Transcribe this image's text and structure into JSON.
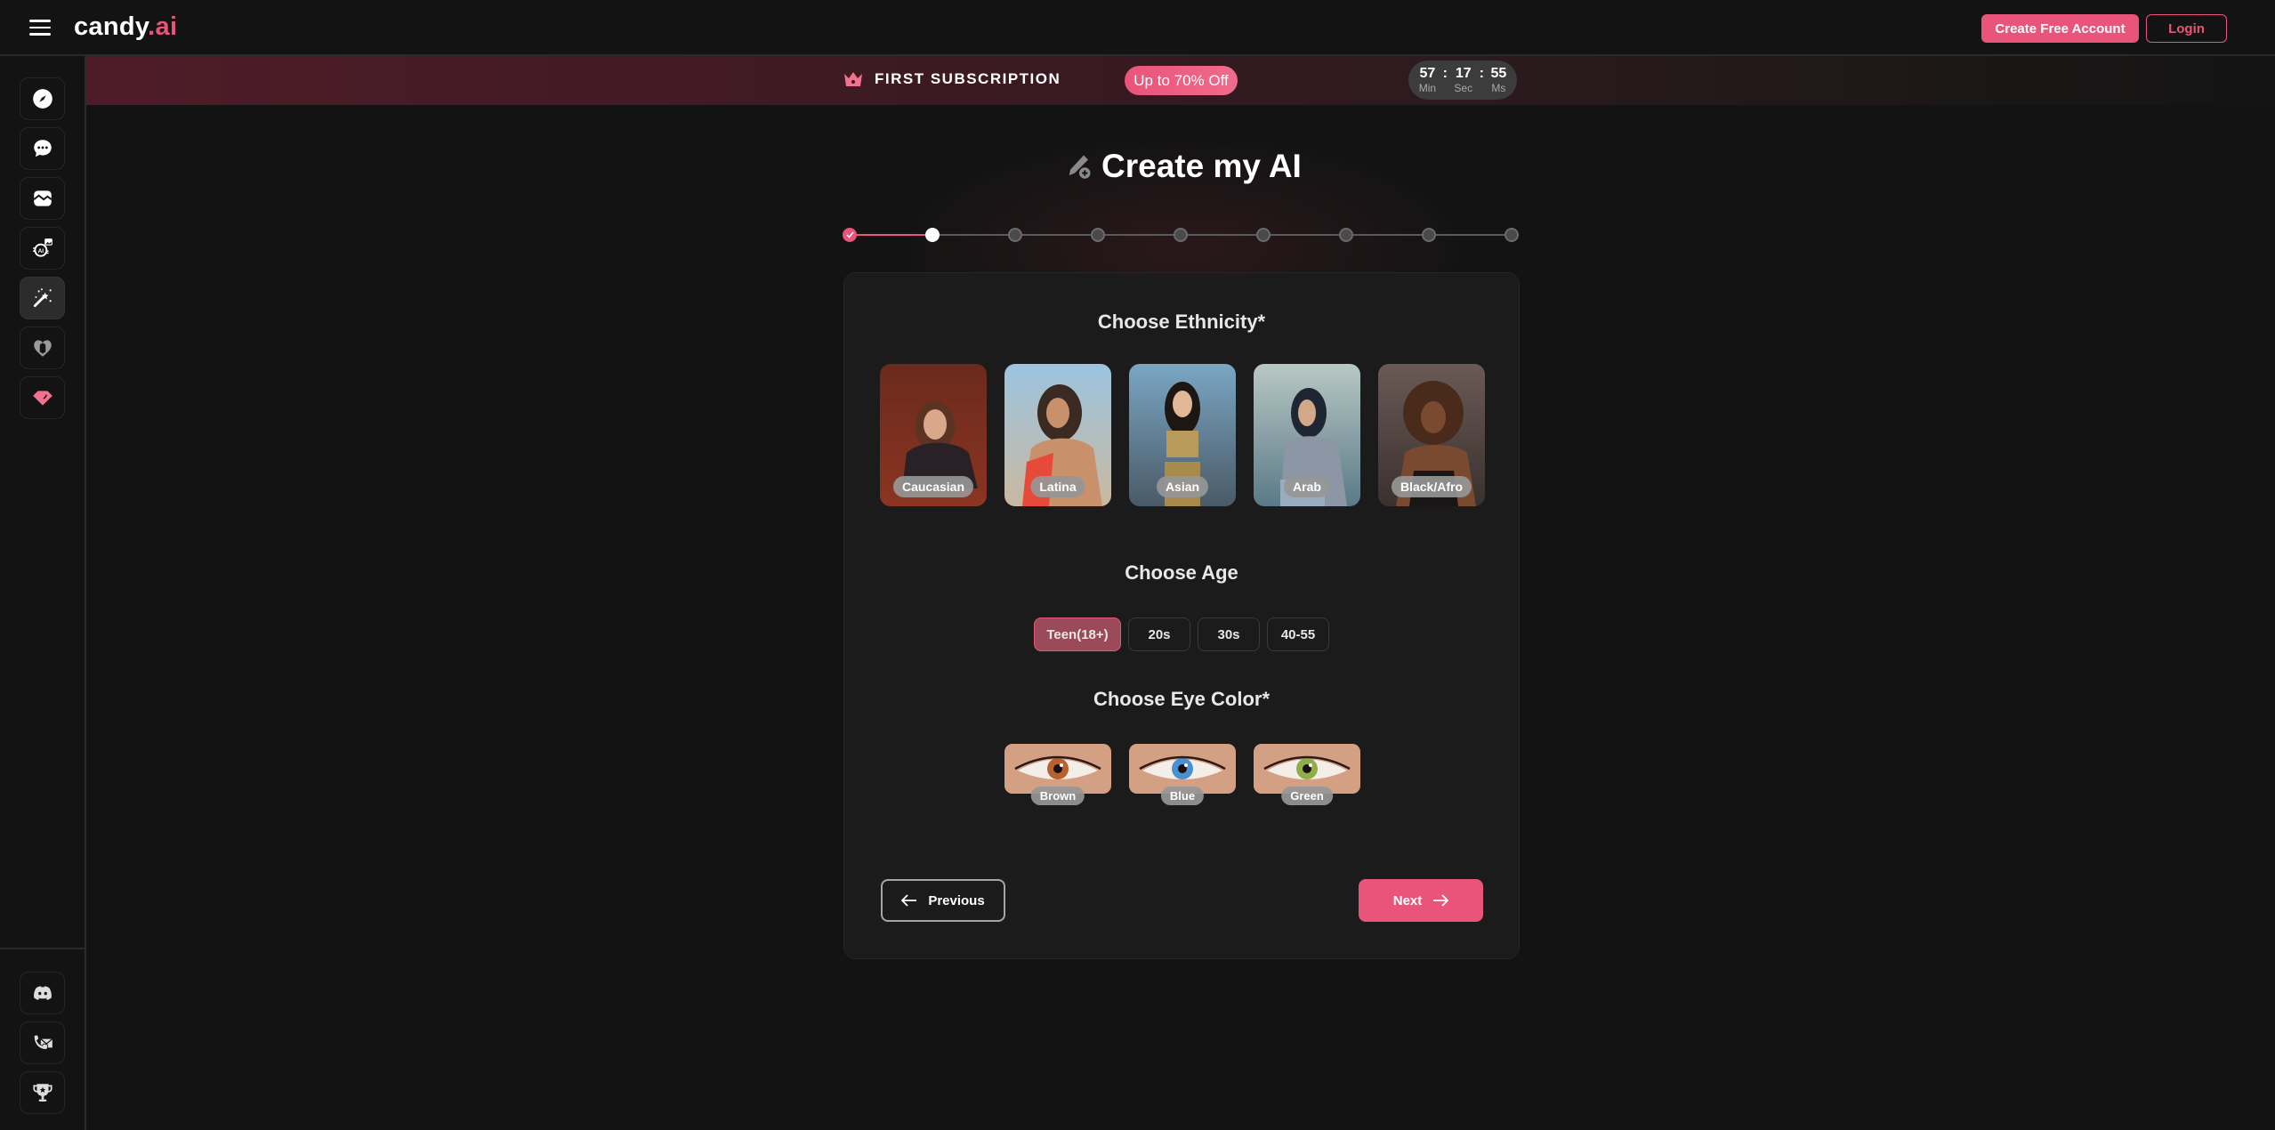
{
  "header": {
    "logo_main": "candy",
    "logo_accent": ".ai",
    "create_account_label": "Create Free Account",
    "login_label": "Login",
    "menu_icon": "hamburger-icon"
  },
  "sidebar": {
    "top_items": [
      {
        "name": "explore",
        "icon": "compass-icon",
        "active": false
      },
      {
        "name": "chat",
        "icon": "chat-bubble-icon",
        "active": false
      },
      {
        "name": "gallery",
        "icon": "image-icon",
        "active": false
      },
      {
        "name": "generate-image",
        "icon": "ai-image-icon",
        "active": false
      },
      {
        "name": "create-character",
        "icon": "magic-wand-icon",
        "active": true
      },
      {
        "name": "my-ai",
        "icon": "heart-icon",
        "active": false
      },
      {
        "name": "premium",
        "icon": "diamond-icon",
        "active": false
      }
    ],
    "bottom_items": [
      {
        "name": "discord",
        "icon": "discord-icon"
      },
      {
        "name": "contact",
        "icon": "phone-mail-icon"
      },
      {
        "name": "affiliate",
        "icon": "trophy-icon"
      }
    ]
  },
  "promo": {
    "title": "FIRST SUBSCRIPTION",
    "badge": "Up to 70% Off",
    "timer": {
      "minutes": "57",
      "seconds": "17",
      "ms": "55",
      "min_label": "Min",
      "sec_label": "Sec",
      "ms_label": "Ms"
    }
  },
  "page": {
    "title": "Create my AI",
    "stepper": {
      "total_steps": 9,
      "current_step": 2,
      "completed_steps": 1
    }
  },
  "ethnicity": {
    "title": "Choose Ethnicity*",
    "options": [
      {
        "label": "Caucasian"
      },
      {
        "label": "Latina"
      },
      {
        "label": "Asian"
      },
      {
        "label": "Arab"
      },
      {
        "label": "Black/Afro"
      }
    ]
  },
  "age": {
    "title": "Choose Age",
    "options": [
      {
        "label": "Teen(18+)",
        "selected": true
      },
      {
        "label": "20s",
        "selected": false
      },
      {
        "label": "30s",
        "selected": false
      },
      {
        "label": "40-55",
        "selected": false
      }
    ]
  },
  "eye_color": {
    "title": "Choose Eye Color*",
    "options": [
      {
        "label": "Brown",
        "iris": "#b8612f"
      },
      {
        "label": "Blue",
        "iris": "#4a8fd0"
      },
      {
        "label": "Green",
        "iris": "#8fae4a"
      }
    ]
  },
  "nav": {
    "previous_label": "Previous",
    "next_label": "Next"
  },
  "colors": {
    "accent": "#e9547a",
    "background": "#131313",
    "card": "#1b1b1b",
    "age_selected": "#9b4a5a"
  }
}
